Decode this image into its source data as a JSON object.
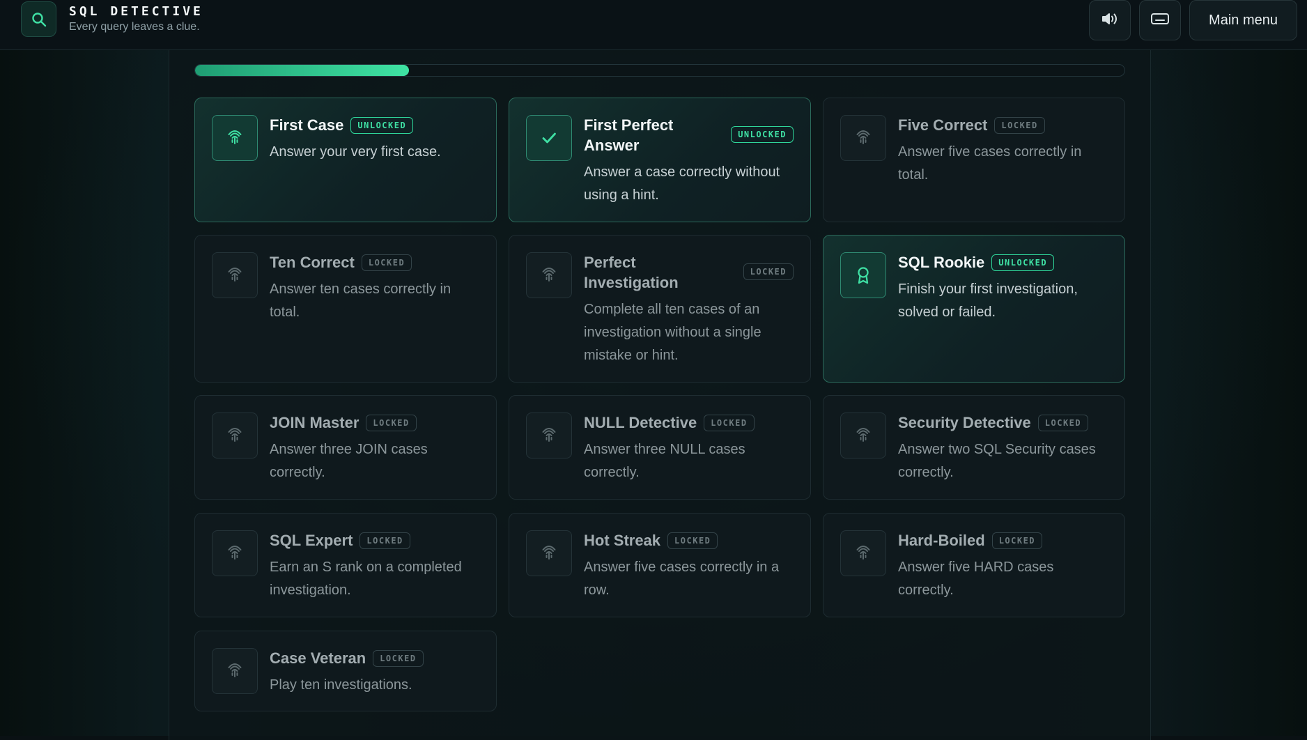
{
  "app": {
    "title": "SQL DETECTIVE",
    "tagline": "Every query leaves a clue."
  },
  "toolbar": {
    "sound_icon": "speaker-icon",
    "keyboard_icon": "keyboard-icon",
    "main_menu_label": "Main menu"
  },
  "progress": {
    "fraction": 0.23
  },
  "colors": {
    "accent": "#3fe0a4",
    "accent_dark": "#1f9d73"
  },
  "achievements": [
    {
      "title": "First Case",
      "status": "UNLOCKED",
      "desc": "Answer your very first case.",
      "icon": "fingerprint-icon"
    },
    {
      "title": "First Perfect Answer",
      "status": "UNLOCKED",
      "desc": "Answer a case correctly without using a hint.",
      "icon": "check-icon"
    },
    {
      "title": "Five Correct",
      "status": "LOCKED",
      "desc": "Answer five cases correctly in total.",
      "icon": "fingerprint-icon"
    },
    {
      "title": "Ten Correct",
      "status": "LOCKED",
      "desc": "Answer ten cases correctly in total.",
      "icon": "fingerprint-icon"
    },
    {
      "title": "Perfect Investigation",
      "status": "LOCKED",
      "desc": "Complete all ten cases of an investigation without a single mistake or hint.",
      "icon": "fingerprint-icon"
    },
    {
      "title": "SQL Rookie",
      "status": "UNLOCKED",
      "desc": "Finish your first investigation, solved or failed.",
      "icon": "award-icon"
    },
    {
      "title": "JOIN Master",
      "status": "LOCKED",
      "desc": "Answer three JOIN cases correctly.",
      "icon": "fingerprint-icon"
    },
    {
      "title": "NULL Detective",
      "status": "LOCKED",
      "desc": "Answer three NULL cases correctly.",
      "icon": "fingerprint-icon"
    },
    {
      "title": "Security Detective",
      "status": "LOCKED",
      "desc": "Answer two SQL Security cases correctly.",
      "icon": "fingerprint-icon"
    },
    {
      "title": "SQL Expert",
      "status": "LOCKED",
      "desc": "Earn an S rank on a completed investigation.",
      "icon": "fingerprint-icon"
    },
    {
      "title": "Hot Streak",
      "status": "LOCKED",
      "desc": "Answer five cases correctly in a row.",
      "icon": "fingerprint-icon"
    },
    {
      "title": "Hard-Boiled",
      "status": "LOCKED",
      "desc": "Answer five HARD cases correctly.",
      "icon": "fingerprint-icon"
    },
    {
      "title": "Case Veteran",
      "status": "LOCKED",
      "desc": "Play ten investigations.",
      "icon": "fingerprint-icon"
    }
  ]
}
